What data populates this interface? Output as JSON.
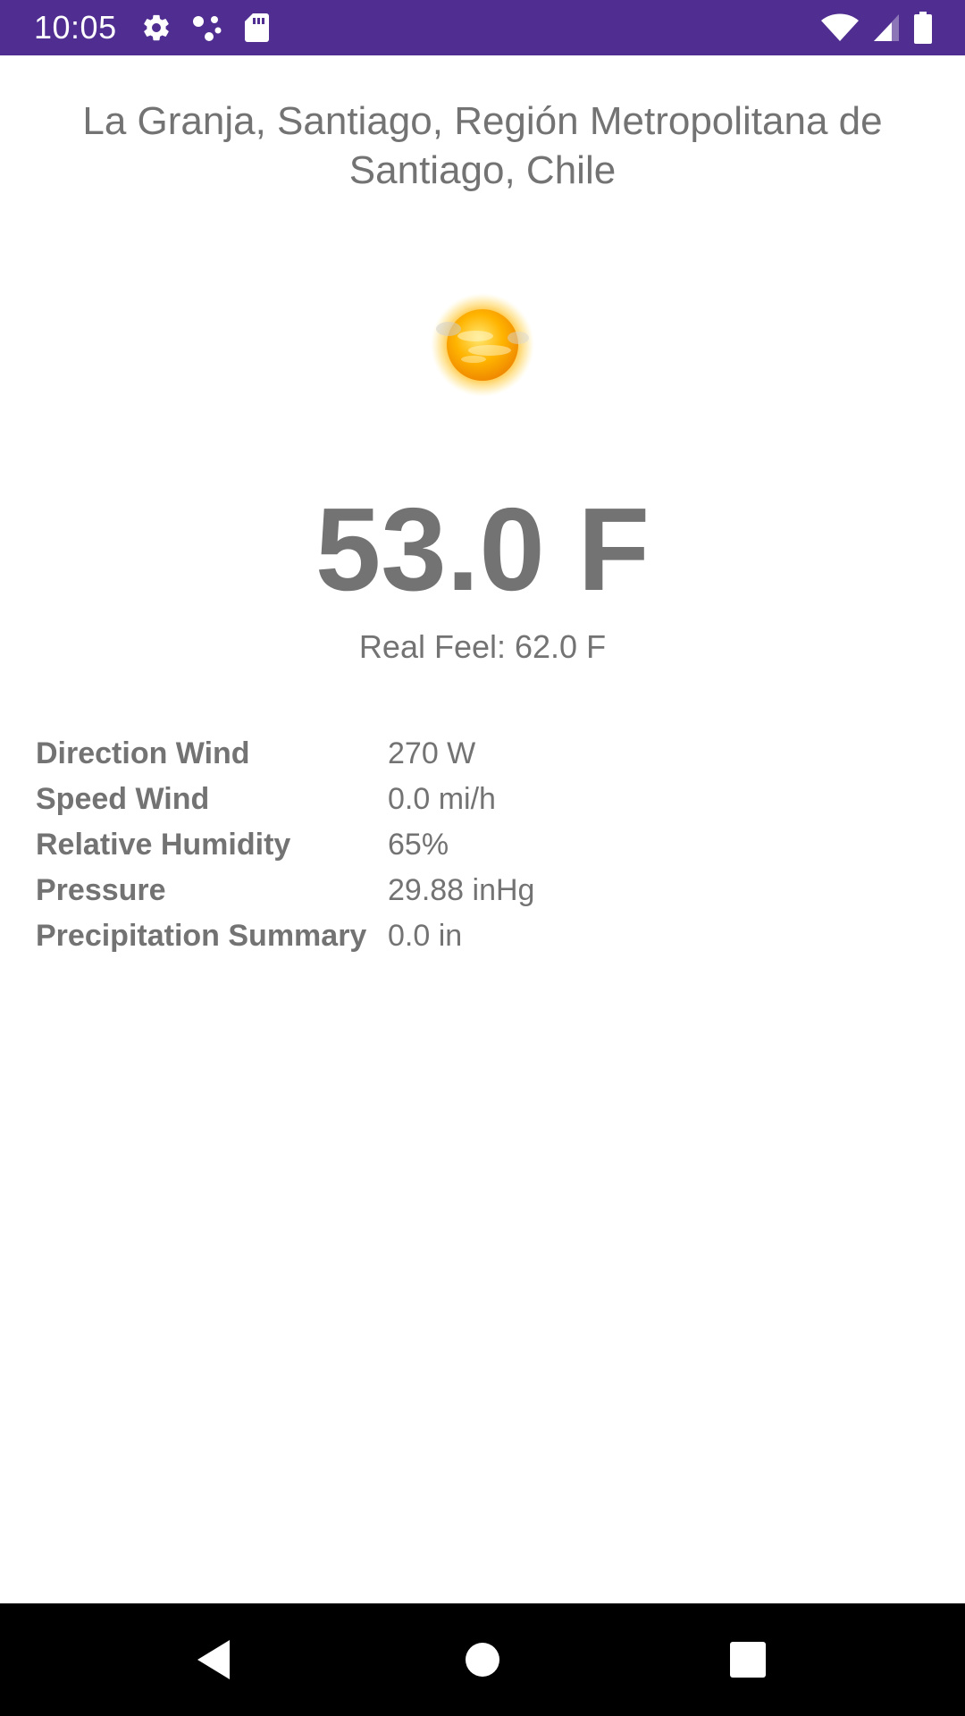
{
  "status_bar": {
    "time": "10:05",
    "left_icons": [
      "settings-icon",
      "dots-icon",
      "sd-card-icon"
    ],
    "right_icons": [
      "wifi-icon",
      "cell-signal-icon",
      "battery-icon"
    ],
    "background": "#4f2d91"
  },
  "weather": {
    "location": "La Granja, Santiago, Región Metropolitana de Santiago, Chile",
    "icon": "sun-haze-icon",
    "temperature": "53.0 F",
    "real_feel": "Real Feel: 62.0 F"
  },
  "details": [
    {
      "label": "Direction Wind",
      "value": "270 W"
    },
    {
      "label": "Speed Wind",
      "value": "0.0 mi/h"
    },
    {
      "label": "Relative Humidity",
      "value": "65%"
    },
    {
      "label": "Pressure",
      "value": "29.88 inHg"
    },
    {
      "label": "Precipitation Summary",
      "value": "0.0 in"
    }
  ],
  "nav_bar": {
    "buttons": [
      "back-icon",
      "home-icon",
      "recents-icon"
    ]
  }
}
